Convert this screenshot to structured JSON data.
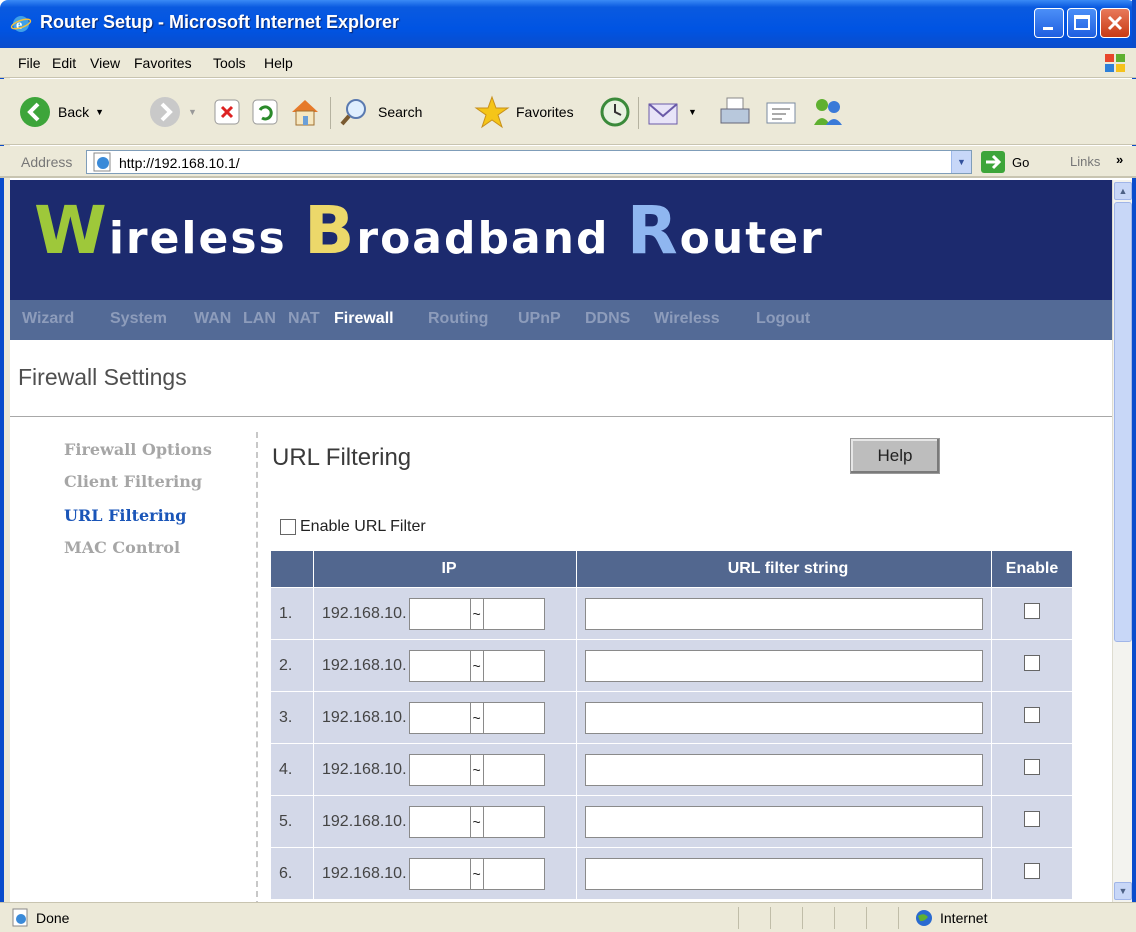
{
  "window": {
    "title": "Router Setup - Microsoft Internet Explorer"
  },
  "menu": [
    "File",
    "Edit",
    "View",
    "Favorites",
    "Tools",
    "Help"
  ],
  "toolbar": {
    "back": "Back",
    "search": "Search",
    "favorites": "Favorites"
  },
  "address": {
    "label": "Address",
    "url": "http://192.168.10.1/",
    "go": "Go",
    "links": "Links"
  },
  "banner": {
    "w": "W",
    "w_rest": "ireless ",
    "b": "B",
    "b_rest": "roadband ",
    "r": "R",
    "r_rest": "outer"
  },
  "nav": [
    "Wizard",
    "System",
    "WAN",
    "LAN",
    "NAT",
    "Firewall",
    "Routing",
    "UPnP",
    "DDNS",
    "Wireless",
    "Logout"
  ],
  "nav_active": "Firewall",
  "page_title": "Firewall Settings",
  "sidebar": [
    "Firewall Options",
    "Client Filtering",
    "URL Filtering",
    "MAC Control"
  ],
  "sidebar_active": "URL Filtering",
  "section": {
    "title": "URL Filtering",
    "help": "Help",
    "enable_label": "Enable URL Filter",
    "enable_checked": false
  },
  "table": {
    "headers": [
      "IP",
      "URL filter string",
      "Enable"
    ],
    "rows": [
      {
        "num": "1.",
        "prefix": "192.168.10.",
        "tilde": "~"
      },
      {
        "num": "2.",
        "prefix": "192.168.10.",
        "tilde": "~"
      },
      {
        "num": "3.",
        "prefix": "192.168.10.",
        "tilde": "~"
      },
      {
        "num": "4.",
        "prefix": "192.168.10.",
        "tilde": "~"
      },
      {
        "num": "5.",
        "prefix": "192.168.10.",
        "tilde": "~"
      },
      {
        "num": "6.",
        "prefix": "192.168.10.",
        "tilde": "~"
      }
    ]
  },
  "status": {
    "text": "Done",
    "zone": "Internet"
  },
  "colors": {
    "banner_bg": "#1c2a6e",
    "nav_bg": "#536a96",
    "table_header": "#52678f",
    "table_cell": "#d3d8e8",
    "link_active": "#1a55b8"
  }
}
